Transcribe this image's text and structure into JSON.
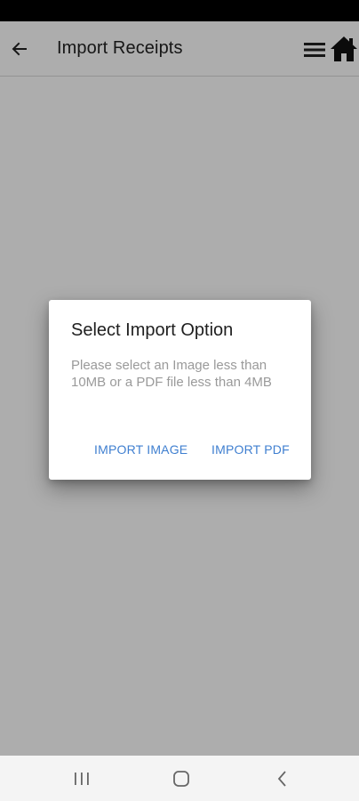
{
  "app_bar": {
    "title": "Import Receipts",
    "icons": {
      "back": "arrow-left-icon",
      "menu": "hamburger-menu-icon",
      "home": "home-icon"
    }
  },
  "dialog": {
    "title": "Select Import Option",
    "message": "Please select an Image less than 10MB or a PDF file less than 4MB",
    "actions": {
      "import_image": "IMPORT IMAGE",
      "import_pdf": "IMPORT PDF"
    }
  },
  "nav_bar": {
    "icons": [
      "recents-icon",
      "home-circle-icon",
      "back-chevron-icon"
    ]
  },
  "colors": {
    "accent": "#3f7fd0",
    "status_bar": "#000000",
    "scrim": "rgba(0,0,0,0.32)"
  }
}
